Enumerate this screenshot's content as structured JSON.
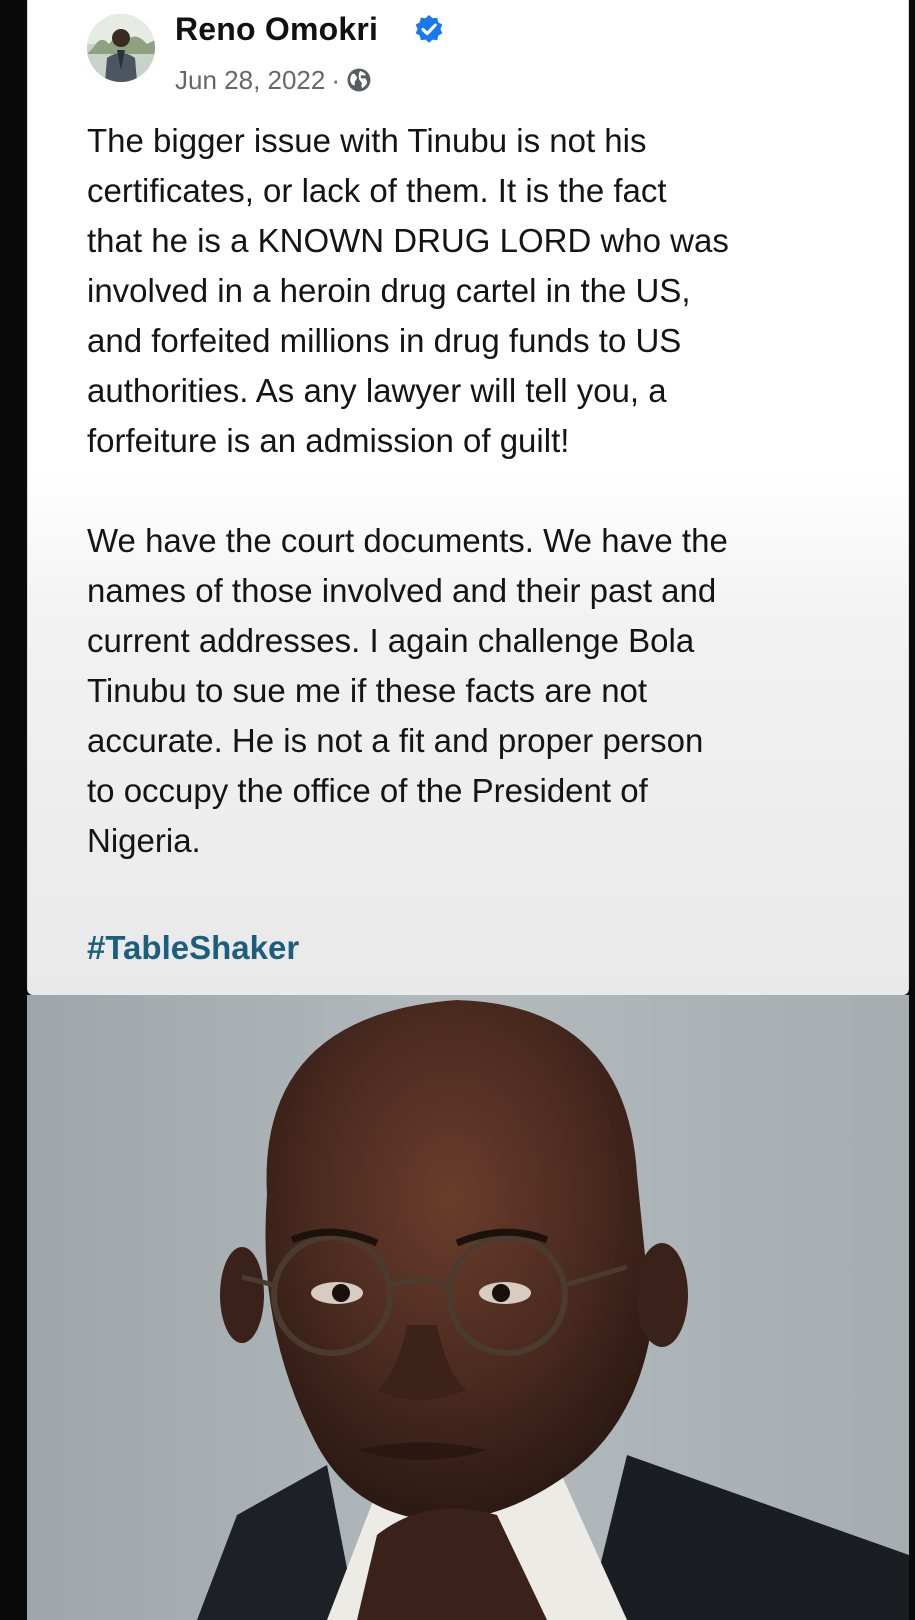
{
  "post": {
    "author": "Reno Omokri",
    "verified": true,
    "date": "Jun 28, 2022",
    "separator": "·",
    "audience_icon": "globe-icon",
    "body_paragraph_1": "The bigger issue with Tinubu is not his\ncertificates, or lack of them. It is the fact\nthat he is a KNOWN DRUG LORD who was\ninvolved in a heroin drug cartel in the US,\nand forfeited millions in drug funds to US\nauthorities. As any lawyer will tell you, a\nforfeiture is an admission of guilt!",
    "body_paragraph_2": "We have the court documents. We have the\nnames of those involved and their past and\ncurrent addresses. I again challenge Bola\nTinubu to sue me if these facts are not\naccurate. He is not a fit and proper person\nto occupy the office of the President of\nNigeria.",
    "hashtag": "#TableShaker"
  },
  "colors": {
    "verified_badge": "#1877f2",
    "hashtag": "#1b5f7e",
    "meta_text": "#66676b",
    "body_text": "#141414"
  }
}
